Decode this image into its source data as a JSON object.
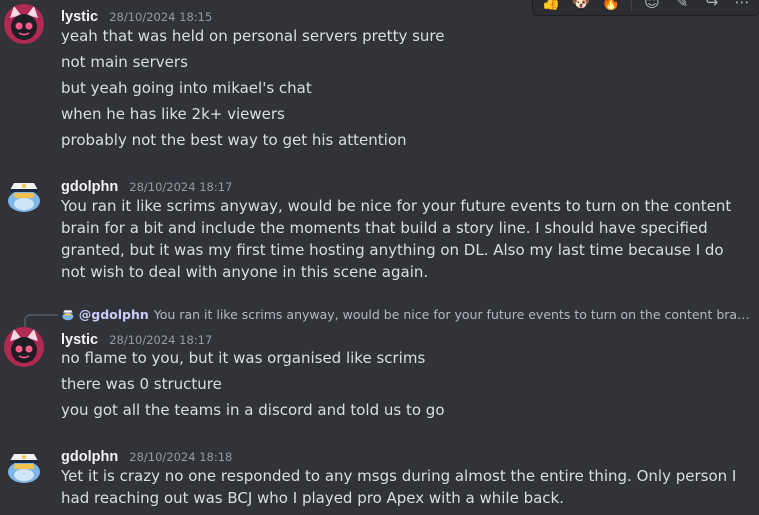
{
  "messages": [
    {
      "author": "lystic",
      "timestamp": "28/10/2024 18:15",
      "lines": [
        "yeah that was held on personal servers pretty sure",
        "not main servers",
        "but yeah going into mikael's chat",
        "when he has like 2k+ viewers",
        "probably not the best way to get his attention"
      ]
    },
    {
      "author": "gdolphn",
      "timestamp": "28/10/2024 18:17",
      "text": "You ran it like scrims anyway, would be nice for your future events to turn on the content brain for a bit and include the moments that build a story line. I should have specified granted, but it was my first time hosting anything on DL. Also my last time because I do not wish to deal with anyone in this scene again."
    },
    {
      "reply": {
        "mention": "@gdolphn",
        "snippet": "You ran it like scrims anyway, would be nice for your future events to turn on the content brain…"
      },
      "author": "lystic",
      "timestamp": "28/10/2024 18:17",
      "lines": [
        "no flame to you, but it was organised like scrims",
        "there was 0 structure",
        "you got all the teams in a discord and told us to go"
      ]
    },
    {
      "author": "gdolphn",
      "timestamp": "28/10/2024 18:18",
      "text": "Yet it is crazy no one responded to any msgs during almost the entire thing. Only person I had reaching out was BCJ who I played pro Apex with a while back."
    }
  ],
  "toolbar": {
    "icons": [
      "thumbs-up-emoji",
      "dog-emoji",
      "fire-emoji",
      "add-reaction-icon",
      "edit-icon",
      "forward-icon",
      "more-icon"
    ],
    "glyphs": [
      "👍",
      "🐶",
      "🔥",
      "☺",
      "✎",
      "↪",
      "⋯"
    ]
  },
  "colors": {
    "background": "#313338",
    "username": "#f2f3f5",
    "timestamp": "#949ba4",
    "text": "#dbdee1",
    "mention": "#c9cdfb",
    "lystic_avatar": "#b02a52",
    "gdolphn_avatar": "#7fb6e8"
  }
}
